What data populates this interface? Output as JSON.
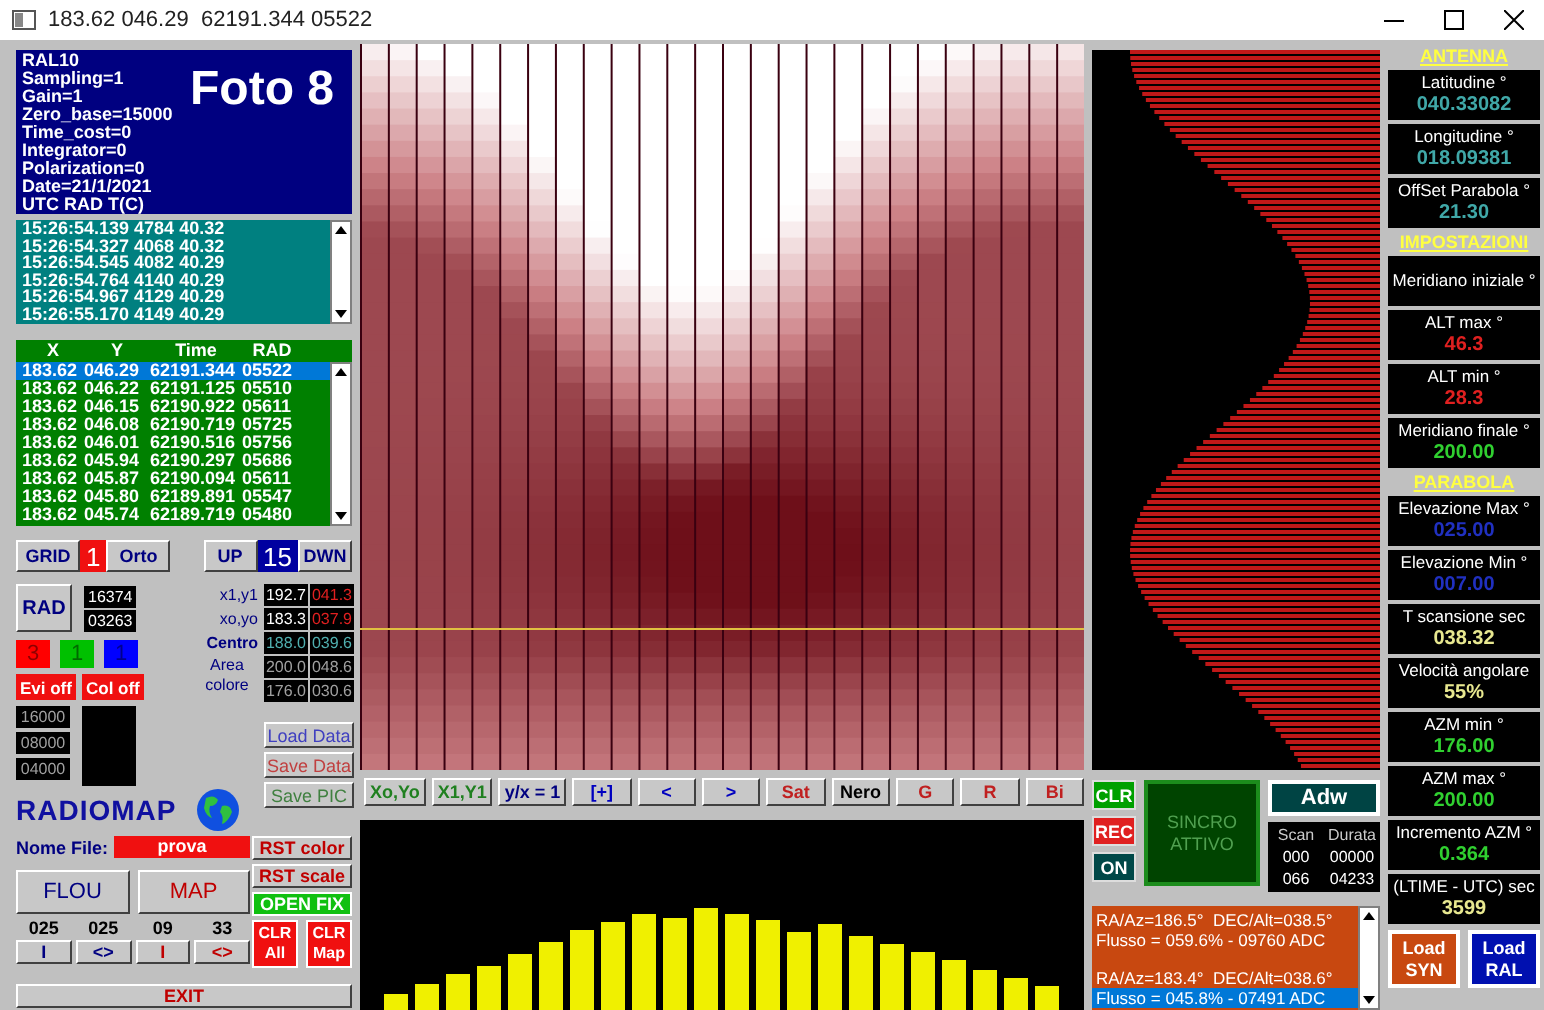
{
  "window": {
    "title": "183.62 046.29  62191.344 05522"
  },
  "info": {
    "lines": [
      "RAL10",
      "Sampling=1",
      "Gain=1",
      "Zero_base=15000",
      "Time_cost=0",
      "Integrator=0",
      "Polarization=0",
      "Date=21/1/2021",
      "UTC RAD T(C)"
    ],
    "photo_label": "Foto 8"
  },
  "log": {
    "rows": [
      "15:26:54.139 4784 40.32",
      "15:26:54.327 4068 40.32",
      "15:26:54.545 4082 40.29",
      "15:26:54.764 4140 40.29",
      "15:26:54.967 4129 40.29",
      "15:26:55.170 4149 40.29"
    ]
  },
  "points": {
    "columns": [
      "X",
      "Y",
      "Time",
      "RAD"
    ],
    "rows": [
      {
        "cells": [
          "183.62",
          "046.29",
          "62191.344",
          "05522"
        ],
        "selected": true
      },
      {
        "cells": [
          "183.62",
          "046.22",
          "62191.125",
          "05510"
        ],
        "selected": false
      },
      {
        "cells": [
          "183.62",
          "046.15",
          "62190.922",
          "05611"
        ],
        "selected": false
      },
      {
        "cells": [
          "183.62",
          "046.08",
          "62190.719",
          "05725"
        ],
        "selected": false
      },
      {
        "cells": [
          "183.62",
          "046.01",
          "62190.516",
          "05756"
        ],
        "selected": false
      },
      {
        "cells": [
          "183.62",
          "045.94",
          "62190.297",
          "05686"
        ],
        "selected": false
      },
      {
        "cells": [
          "183.62",
          "045.87",
          "62190.094",
          "05611"
        ],
        "selected": false
      },
      {
        "cells": [
          "183.62",
          "045.80",
          "62189.891",
          "05547"
        ],
        "selected": false
      },
      {
        "cells": [
          "183.62",
          "045.74",
          "62189.719",
          "05480"
        ],
        "selected": false
      }
    ]
  },
  "grid": {
    "button": "GRID",
    "value": "1",
    "ortho_button": "Orto"
  },
  "step": {
    "up": "UP",
    "value": "15",
    "down": "DWN"
  },
  "rad": {
    "button": "RAD",
    "readings": [
      "16374",
      "03263"
    ]
  },
  "coords": {
    "rows": [
      {
        "label": "x1,y1",
        "kind": "point",
        "values": [
          "192.7",
          "041.3"
        ]
      },
      {
        "label": "xo,yo",
        "kind": "point",
        "values": [
          "183.3",
          "037.9"
        ]
      },
      {
        "label": "Centro",
        "kind": "center",
        "values": [
          "188.0",
          "039.6"
        ]
      }
    ],
    "area": {
      "label": "Area colore",
      "rows": [
        [
          "200.0",
          "048.6"
        ],
        [
          "176.0",
          "030.6"
        ]
      ]
    }
  },
  "channels": [
    {
      "value": "3",
      "color": "#ff0000"
    },
    {
      "value": "1",
      "color": "#00c000"
    },
    {
      "value": "1",
      "color": "#0000ff"
    }
  ],
  "toggles": [
    "Evi off",
    "Col off"
  ],
  "scale": [
    "16000",
    "08000",
    "04000"
  ],
  "data_buttons": [
    {
      "label": "Load Data",
      "color": "#4040c0"
    },
    {
      "label": "Save Data",
      "color": "#c04040"
    },
    {
      "label": "Save PIC",
      "color": "#408040"
    }
  ],
  "logo": "RADIOMAP",
  "file": {
    "label": "Nome File:",
    "value": "prova"
  },
  "reset_buttons": [
    "RST color",
    "RST scale"
  ],
  "fix_button": "OPEN FIX",
  "main_buttons": [
    {
      "label": "FLOU",
      "color": "#000080"
    },
    {
      "label": "MAP",
      "color": "#c00000"
    }
  ],
  "steppers": [
    {
      "value": "025",
      "button": "I",
      "color": "#000080"
    },
    {
      "value": "025",
      "button": "<>",
      "color": "#000080"
    },
    {
      "value": "09",
      "button": "I",
      "color": "#c00000"
    },
    {
      "value": "33",
      "button": "<>",
      "color": "#c00000"
    }
  ],
  "clear_buttons": [
    "CLR All",
    "CLR Map"
  ],
  "exit": "EXIT",
  "toolbar": [
    {
      "label": "Xo,Yo",
      "color": "#208020"
    },
    {
      "label": "X1,Y1",
      "color": "#208020"
    },
    {
      "label": "y/x = 1",
      "color": "#000080"
    },
    {
      "label": "[+]",
      "color": "#0000c0"
    },
    {
      "label": "<",
      "color": "#0000c0"
    },
    {
      "label": ">",
      "color": "#0000c0"
    },
    {
      "label": "Sat",
      "color": "#c02020"
    },
    {
      "label": "Nero",
      "color": "#000000"
    },
    {
      "label": "G",
      "color": "#c02020"
    },
    {
      "label": "R",
      "color": "#c02020"
    },
    {
      "label": "Bi",
      "color": "#c02020"
    }
  ],
  "sync": {
    "side_buttons": [
      {
        "label": "CLR",
        "color": "#00a000"
      },
      {
        "label": "REC",
        "color": "#e02020"
      },
      {
        "label": "ON",
        "color": "#004848"
      }
    ],
    "status": "SINCRO ATTIVO",
    "mode_button": "Adw",
    "scan": {
      "columns": [
        "Scan",
        "Durata"
      ],
      "rows": [
        [
          "000",
          "00000"
        ],
        [
          "066",
          "04233"
        ]
      ]
    }
  },
  "readout": [
    {
      "kind": "position",
      "text": "RA/Az=186.5°  DEC/Alt=038.5°",
      "selected": false
    },
    {
      "kind": "flux",
      "text": "Flusso = 059.6% - 09760 ADC",
      "selected": false
    },
    {
      "kind": "position",
      "text": "RA/Az=183.4°  DEC/Alt=038.6°",
      "selected": false
    },
    {
      "kind": "flux",
      "text": "Flusso = 045.8% - 07491 ADC",
      "selected": true
    }
  ],
  "settings": [
    {
      "title": "ANTENNA",
      "fields": [
        {
          "label": "Latitudine °",
          "value": "040.33082",
          "color": "#40a8a8"
        },
        {
          "label": "Longitudine °",
          "value": "018.09381",
          "color": "#40a8a8"
        },
        {
          "label": "OffSet Parabola °",
          "value": "21.30",
          "color": "#40a8a8"
        }
      ]
    },
    {
      "title": "IMPOSTAZIONI",
      "fields": [
        {
          "label": "Meridiano iniziale °"
        },
        {
          "label": "ALT max °",
          "value": "46.3",
          "color": "#e02020"
        },
        {
          "label": "ALT min °",
          "value": "28.3",
          "color": "#e02020"
        },
        {
          "label": "Meridiano finale °",
          "value": "200.00",
          "color": "#30d030"
        }
      ]
    },
    {
      "title": "PARABOLA",
      "fields": [
        {
          "label": "Elevazione Max °",
          "value": "025.00",
          "color": "#2030c0"
        },
        {
          "label": "Elevazione Min °",
          "value": "007.00",
          "color": "#2030c0"
        },
        {
          "label": "T scansione sec",
          "value": "038.32",
          "color": "#e8e890"
        },
        {
          "label": "Velocità angolare",
          "value": "55%",
          "color": "#e8e890"
        },
        {
          "label": "AZM min °",
          "value": "176.00",
          "color": "#30d030"
        },
        {
          "label": "AZM max °",
          "value": "200.00",
          "color": "#30d030"
        },
        {
          "label": "Incremento AZM °",
          "value": "0.364",
          "color": "#30d030"
        },
        {
          "label": "(LTIME - UTC) sec",
          "value": "3599",
          "color": "#e8e890"
        }
      ]
    }
  ],
  "load_buttons": [
    {
      "label": "Load SYN",
      "color": "#c84810"
    },
    {
      "label": "Load RAL",
      "color": "#0010b0"
    }
  ]
}
